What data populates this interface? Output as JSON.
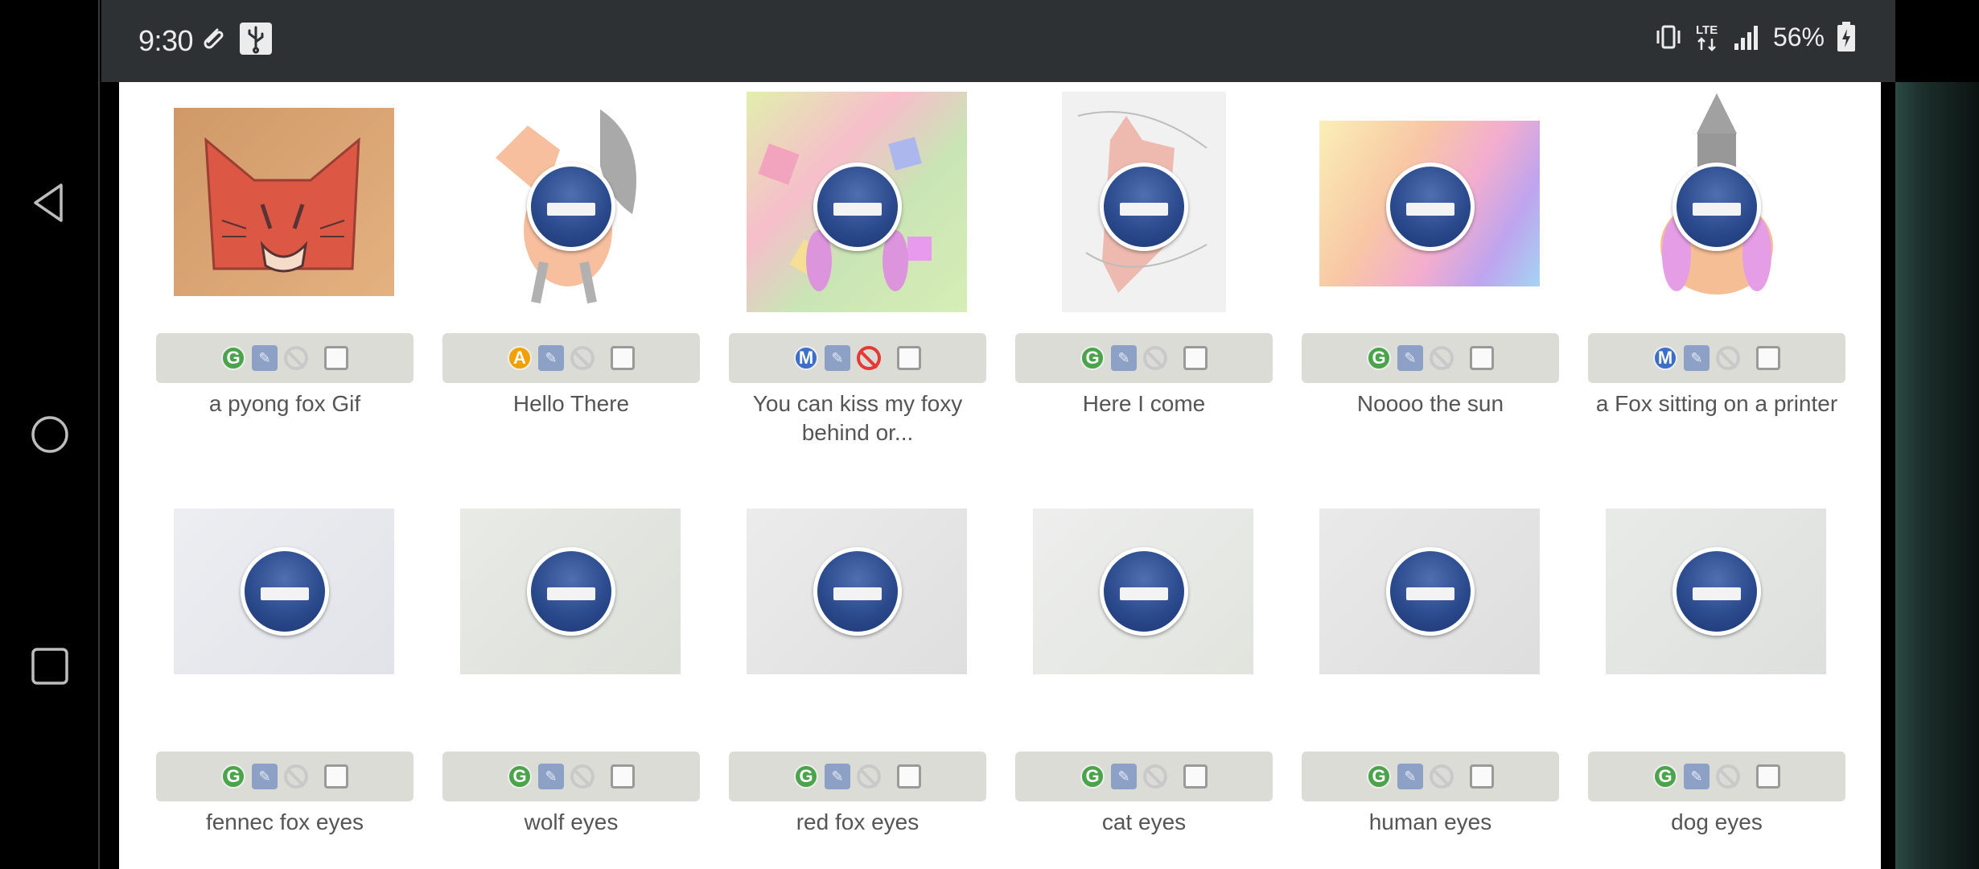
{
  "status": {
    "time": "9:30",
    "battery_pct": "56%",
    "network": "LTE",
    "left_icons": [
      "paperclip-icon",
      "usb-icon"
    ],
    "right_icons": [
      "vibrate-icon",
      "lte-icon",
      "signal-icon",
      "battery-charging-icon"
    ]
  },
  "nav": {
    "buttons": [
      "back-icon",
      "home-icon",
      "recents-icon"
    ]
  },
  "colors": {
    "status_bar": "#2e3134",
    "rating_bar": "#dcdcd7",
    "blocked_icon": "#2b4b8e",
    "badge_g": "#4ba34b",
    "badge_a": "#f0a000",
    "badge_m": "#3c6fc8"
  },
  "gallery": [
    {
      "title": "a pyong fox Gif",
      "rating": "G",
      "blocked": false,
      "nsfw_active": false
    },
    {
      "title": "Hello There",
      "rating": "A",
      "blocked": true,
      "nsfw_active": false
    },
    {
      "title": "You can kiss my foxy behind or...",
      "rating": "M",
      "blocked": true,
      "nsfw_active": true
    },
    {
      "title": "Here I come",
      "rating": "G",
      "blocked": true,
      "nsfw_active": false
    },
    {
      "title": "Noooo the sun",
      "rating": "G",
      "blocked": true,
      "nsfw_active": false
    },
    {
      "title": "a Fox sitting on a printer",
      "rating": "M",
      "blocked": true,
      "nsfw_active": false
    },
    {
      "title": "fennec fox eyes",
      "rating": "G",
      "blocked": true,
      "nsfw_active": false
    },
    {
      "title": "wolf eyes",
      "rating": "G",
      "blocked": true,
      "nsfw_active": false
    },
    {
      "title": "red fox eyes",
      "rating": "G",
      "blocked": true,
      "nsfw_active": false
    },
    {
      "title": "cat eyes",
      "rating": "G",
      "blocked": true,
      "nsfw_active": false
    },
    {
      "title": "human eyes",
      "rating": "G",
      "blocked": true,
      "nsfw_active": false
    },
    {
      "title": "dog eyes",
      "rating": "G",
      "blocked": true,
      "nsfw_active": false
    }
  ]
}
